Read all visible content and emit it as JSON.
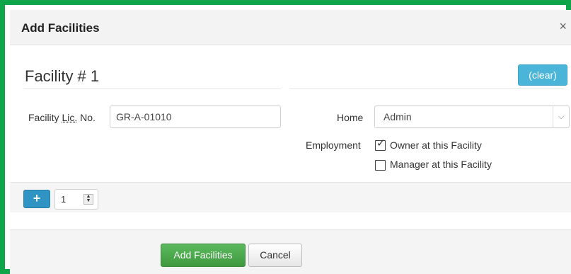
{
  "modal": {
    "title": "Add Facilities",
    "close_glyph": "×"
  },
  "facility": {
    "heading": "Facility # 1",
    "clear_label": "(clear)",
    "license_label_prefix": "Facility ",
    "license_label_abbr": "Lic.",
    "license_label_suffix": " No.",
    "license_value": "GR-A-01010",
    "home_label": "Home",
    "home_value": "Admin",
    "employment_label": "Employment",
    "employment_options": [
      {
        "label": "Owner at this Facility",
        "checked": true
      },
      {
        "label": "Manager at this Facility",
        "checked": false
      }
    ]
  },
  "toolbar": {
    "add_glyph": "+",
    "quantity": "1"
  },
  "footer": {
    "submit_label": "Add Facilities",
    "cancel_label": "Cancel"
  },
  "colors": {
    "frame": "#0fa54a",
    "primary": "#2f93c4",
    "info": "#4ab5d8",
    "success": "#5cb85c"
  }
}
